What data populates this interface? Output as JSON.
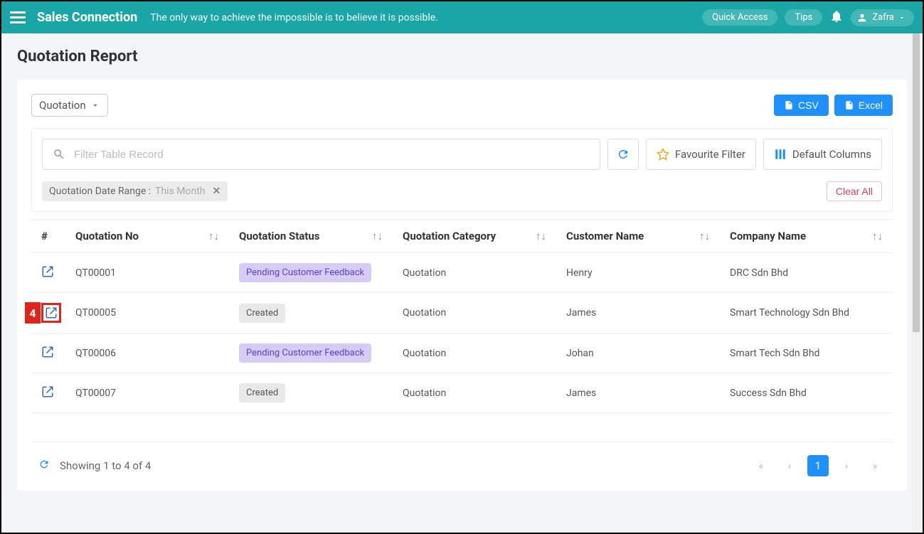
{
  "topbar": {
    "brand": "Sales Connection",
    "tagline": "The only way to achieve the impossible is to believe it is possible.",
    "quick_access": "Quick Access",
    "tips": "Tips",
    "user_name": "Zafra"
  },
  "page": {
    "title": "Quotation Report",
    "dropdown_label": "Quotation",
    "export_csv": "CSV",
    "export_excel": "Excel"
  },
  "filters": {
    "search_placeholder": "Filter Table Record",
    "favourite_label": "Favourite Filter",
    "default_columns_label": "Default Columns",
    "chip_label": "Quotation Date Range :",
    "chip_value": "This Month",
    "clear_all": "Clear All"
  },
  "table": {
    "headers": {
      "hash": "#",
      "qno": "Quotation No",
      "status": "Quotation Status",
      "category": "Quotation Category",
      "customer": "Customer Name",
      "company": "Company Name"
    },
    "rows": [
      {
        "qno": "QT00001",
        "status": "Pending Customer Feedback",
        "status_kind": "pending",
        "category": "Quotation",
        "customer": "Henry",
        "company": "DRC Sdn Bhd",
        "highlighted": false
      },
      {
        "qno": "QT00005",
        "status": "Created",
        "status_kind": "created",
        "category": "Quotation",
        "customer": "James",
        "company": "Smart Technology Sdn Bhd",
        "highlighted": true,
        "callout": "4"
      },
      {
        "qno": "QT00006",
        "status": "Pending Customer Feedback",
        "status_kind": "pending",
        "category": "Quotation",
        "customer": "Johan",
        "company": "Smart Tech Sdn Bhd",
        "highlighted": false
      },
      {
        "qno": "QT00007",
        "status": "Created",
        "status_kind": "created",
        "category": "Quotation",
        "customer": "James",
        "company": "Success Sdn Bhd",
        "highlighted": false
      }
    ]
  },
  "pagination": {
    "info": "Showing 1 to 4 of 4",
    "current": "1"
  }
}
